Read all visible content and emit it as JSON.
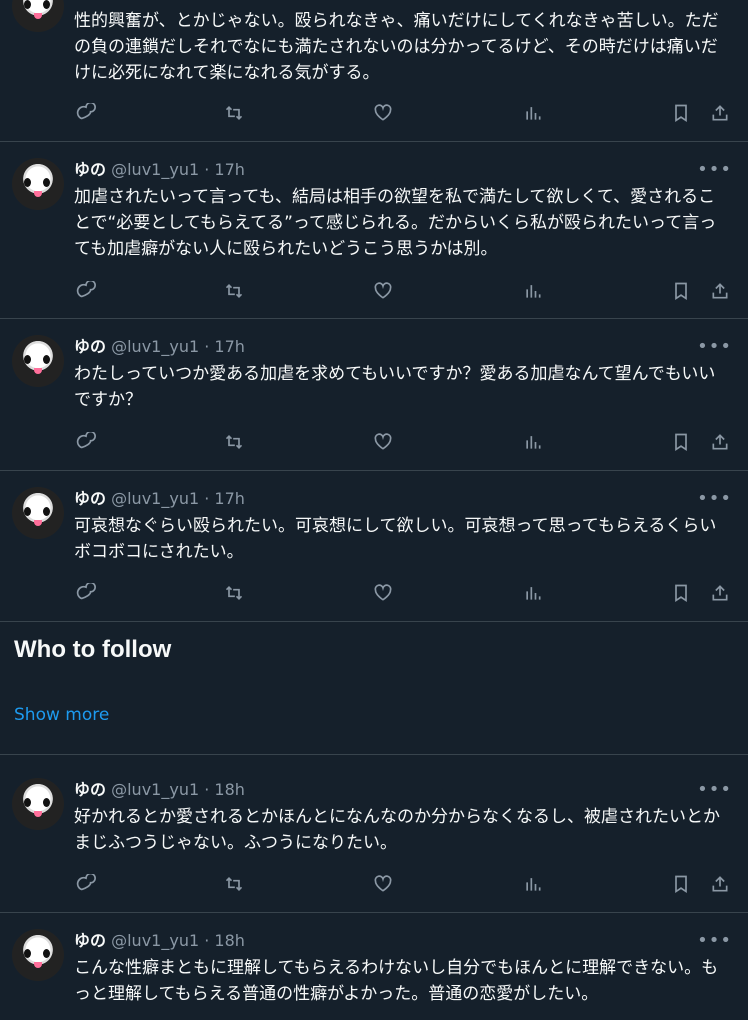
{
  "tweets": [
    {
      "name": "",
      "handle": "",
      "dot": "",
      "time": "",
      "text": "性的興奮が、とかじゃない。殴られなきゃ、痛いだけにしてくれなきゃ苦しい。ただの負の連鎖だしそれでなにも満たされないのは分かってるけど、その時だけは痛いだけに必死になれて楽になれる気がする。"
    },
    {
      "name": "ゆの",
      "handle": "@luv1_yu1",
      "dot": "·",
      "time": "17h",
      "more": "•••",
      "text": "加虐されたいって言っても、結局は相手の欲望を私で満たして欲しくて、愛されることで“必要としてもらえてる”って感じられる。だからいくら私が殴られたいって言っても加虐癖がない人に殴られたいどうこう思うかは別。"
    },
    {
      "name": "ゆの",
      "handle": "@luv1_yu1",
      "dot": "·",
      "time": "17h",
      "more": "•••",
      "text": "わたしっていつか愛ある加虐を求めてもいいですか？愛ある加虐なんて望んでもいいですか？"
    },
    {
      "name": "ゆの",
      "handle": "@luv1_yu1",
      "dot": "·",
      "time": "17h",
      "more": "•••",
      "text": "可哀想なぐらい殴られたい。可哀想にして欲しい。可哀想って思ってもらえるくらいボコボコにされたい。"
    },
    {
      "name": "ゆの",
      "handle": "@luv1_yu1",
      "dot": "·",
      "time": "18h",
      "more": "•••",
      "text": "好かれるとか愛されるとかほんとになんなのか分からなくなるし、被虐されたいとかまじふつうじゃない。ふつうになりたい。"
    },
    {
      "name": "ゆの",
      "handle": "@luv1_yu1",
      "dot": "·",
      "time": "18h",
      "more": "•••",
      "text": "こんな性癖まともに理解してもらえるわけないし自分でもほんとに理解できない。もっと理解してもらえる普通の性癖がよかった。普通の恋愛がしたい。"
    }
  ],
  "who_to_follow": {
    "title": "Who to follow",
    "show_more": "Show more"
  },
  "icons": {
    "reply": "reply-icon",
    "retweet": "retweet-icon",
    "like": "heart-icon",
    "views": "views-icon",
    "bookmark": "bookmark-icon",
    "share": "share-icon"
  }
}
